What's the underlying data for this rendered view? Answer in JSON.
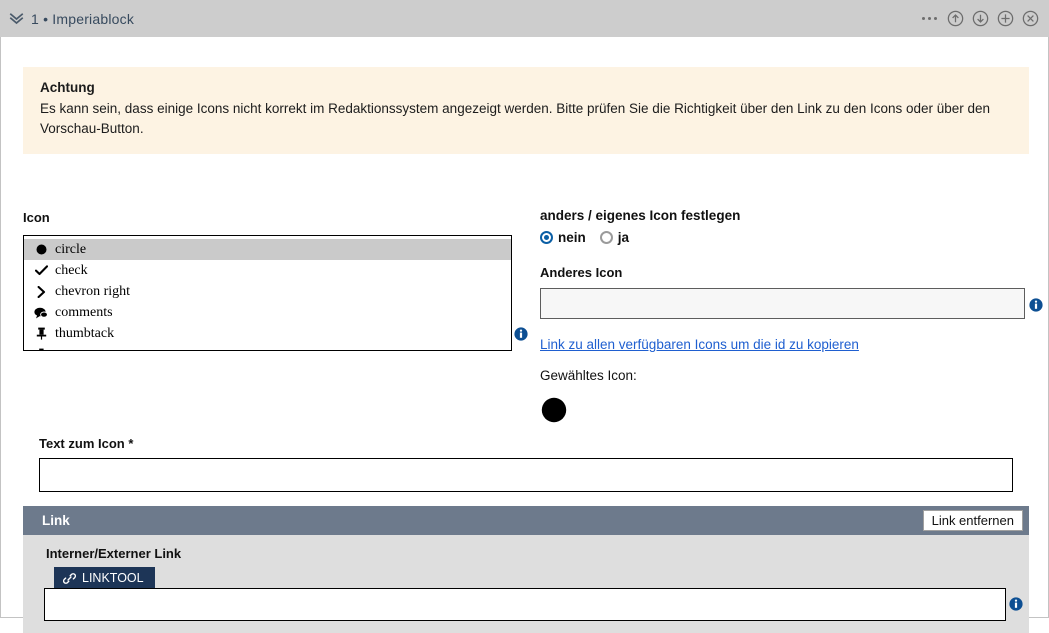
{
  "header": {
    "collapse_icon": "double-chevron-down-icon",
    "number": "1",
    "separator": "•",
    "title": "Imperiablock",
    "title_full": "1 • Imperiablock",
    "icons": [
      {
        "name": "more-options-icon",
        "glyph": "..."
      },
      {
        "name": "move-up-icon",
        "glyph": "↑"
      },
      {
        "name": "move-down-icon",
        "glyph": "↓"
      },
      {
        "name": "add-block-icon",
        "glyph": "+"
      },
      {
        "name": "close-block-icon",
        "glyph": "×"
      }
    ]
  },
  "warning": {
    "title": "Achtung",
    "text": "Es kann sein, dass einige Icons nicht korrekt im Redaktionssystem angezeigt werden. Bitte prüfen Sie die Richtigkeit über den Link zu den Icons oder über den Vorschau-Button.",
    "background": "#fdf3e3"
  },
  "icon_field": {
    "label": "Icon",
    "selected_value": "circle",
    "options": [
      {
        "label": "circle",
        "glyph": "●",
        "selected": true
      },
      {
        "label": "check",
        "glyph": "✔",
        "selected": false
      },
      {
        "label": "chevron right",
        "glyph": "❯",
        "selected": false
      },
      {
        "label": "comments",
        "glyph": "💬",
        "selected": false
      },
      {
        "label": "thumbtack",
        "glyph": "📌",
        "selected": false
      },
      {
        "label": "",
        "glyph": "",
        "selected": false
      }
    ],
    "info_icon": "info-icon"
  },
  "custom_icon": {
    "label": "anders / eigenes Icon festlegen",
    "options": [
      {
        "label": "nein",
        "checked": true
      },
      {
        "label": "ja",
        "checked": false
      }
    ],
    "field_label": "Anderes Icon",
    "field_value": "",
    "field_placeholder": "",
    "info_icon": "info-icon",
    "link_text": "Link zu allen verfügbaren Icons um die id zu kopieren",
    "chosen_label": "Gewähltes Icon:",
    "chosen_glyph": "●"
  },
  "text_zum_icon": {
    "label": "Text zum Icon *",
    "value": "",
    "placeholder": ""
  },
  "link_section": {
    "title": "Link",
    "remove_button": "Link entfernen",
    "sub_label": "Interner/Externer Link",
    "linktool_button": "LINKTOOL",
    "linktool_icon": "chain-link-icon",
    "input_value": "",
    "input_placeholder": "",
    "info_icon": "info-icon"
  },
  "colors": {
    "header_bg": "#cdcdcd",
    "warning_bg": "#fdf3e3",
    "link_header_bg": "#6d7a8c",
    "link_body_bg": "#dedede",
    "linktool_bg": "#1d3557",
    "accent_blue": "#0b5fa5",
    "link_blue": "#1f5fd0",
    "selected_row_bg": "#cacaca"
  }
}
